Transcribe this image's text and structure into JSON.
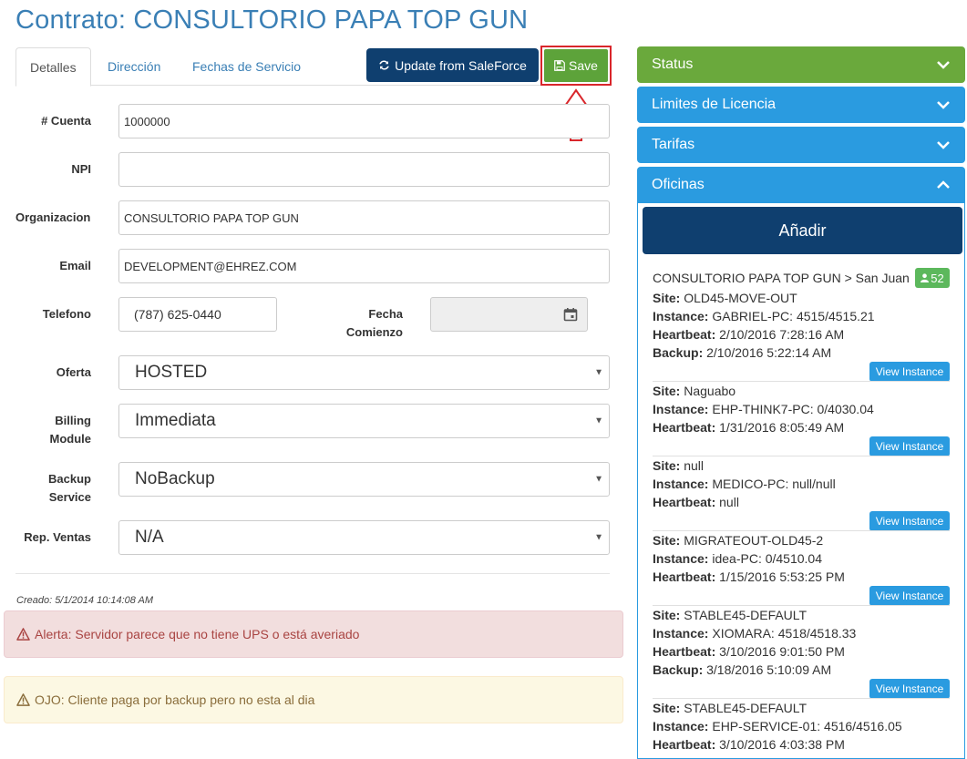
{
  "page": {
    "title": "Contrato: CONSULTORIO PAPA TOP GUN"
  },
  "tabs": [
    {
      "label": "Detalles",
      "active": true
    },
    {
      "label": "Dirección",
      "active": false
    },
    {
      "label": "Fechas de Servicio",
      "active": false
    }
  ],
  "toolbar": {
    "update_label": "Update from SaleForce",
    "save_label": "Save"
  },
  "form": {
    "cuenta": {
      "label": "# Cuenta",
      "value": "1000000"
    },
    "npi": {
      "label": "NPI",
      "value": ""
    },
    "organizacion": {
      "label": "Organizacion",
      "value": "CONSULTORIO PAPA TOP GUN"
    },
    "email": {
      "label": "Email",
      "value": "DEVELOPMENT@EHREZ.COM"
    },
    "telefono": {
      "label": "Telefono",
      "value": "(787) 625-0440"
    },
    "fecha_comienzo": {
      "label_line1": "Fecha",
      "label_line2": "Comienzo",
      "value": ""
    },
    "oferta": {
      "label": "Oferta",
      "value": "HOSTED"
    },
    "billing": {
      "label_line1": "Billing",
      "label_line2": "Module",
      "value": "Immediata"
    },
    "backup": {
      "label_line1": "Backup",
      "label_line2": "Service",
      "value": "NoBackup"
    },
    "ventas": {
      "label": "Rep. Ventas",
      "value": "N/A"
    }
  },
  "created": "Creado: 5/1/2014 10:14:08 AM",
  "alerts": {
    "danger": "Alerta: Servidor parece que no tiene UPS o está averiado",
    "warning": "OJO: Cliente paga por backup pero no esta al dia"
  },
  "panels": {
    "status": "Status",
    "limits": "Limites de Licencia",
    "tarifas": "Tarifas",
    "oficinas": "Oficinas"
  },
  "oficinas": {
    "add_label": "Añadir",
    "office_title": "CONSULTORIO PAPA TOP GUN > San Juan",
    "badge_count": "52",
    "view_label": "View Instance",
    "labels": {
      "site": "Site:",
      "instance": "Instance:",
      "heartbeat": "Heartbeat:",
      "backup": "Backup:"
    },
    "instances": [
      {
        "site": "OLD45-MOVE-OUT",
        "instance": "GABRIEL-PC: 4515/4515.21",
        "heartbeat": "2/10/2016 7:28:16 AM",
        "backup": "2/10/2016 5:22:14 AM"
      },
      {
        "site": "Naguabo",
        "instance": "EHP-THINK7-PC: 0/4030.04",
        "heartbeat": "1/31/2016 8:05:49 AM"
      },
      {
        "site": "null",
        "instance": "MEDICO-PC: null/null",
        "heartbeat": "null"
      },
      {
        "site": "MIGRATEOUT-OLD45-2",
        "instance": "idea-PC: 0/4510.04",
        "heartbeat": "1/15/2016 5:53:25 PM"
      },
      {
        "site": "STABLE45-DEFAULT",
        "instance": "XIOMARA: 4518/4518.33",
        "heartbeat": "3/10/2016 9:01:50 PM",
        "backup": "3/18/2016 5:10:09 AM"
      },
      {
        "site": "STABLE45-DEFAULT",
        "instance": "EHP-SERVICE-01: 4516/4516.05",
        "heartbeat": "3/10/2016 4:03:38 PM"
      }
    ]
  },
  "colors": {
    "title": "#3a7fb5",
    "status": "#6aa93c",
    "panel": "#2a9be0",
    "dark_button": "#0f3f6f",
    "highlight": "#d9262b"
  },
  "icons": {
    "update": "refresh-icon",
    "save": "floppy-icon",
    "calendar": "calendar-icon",
    "chevron": "chevron-icon",
    "alert": "warning-icon",
    "user": "user-icon"
  }
}
